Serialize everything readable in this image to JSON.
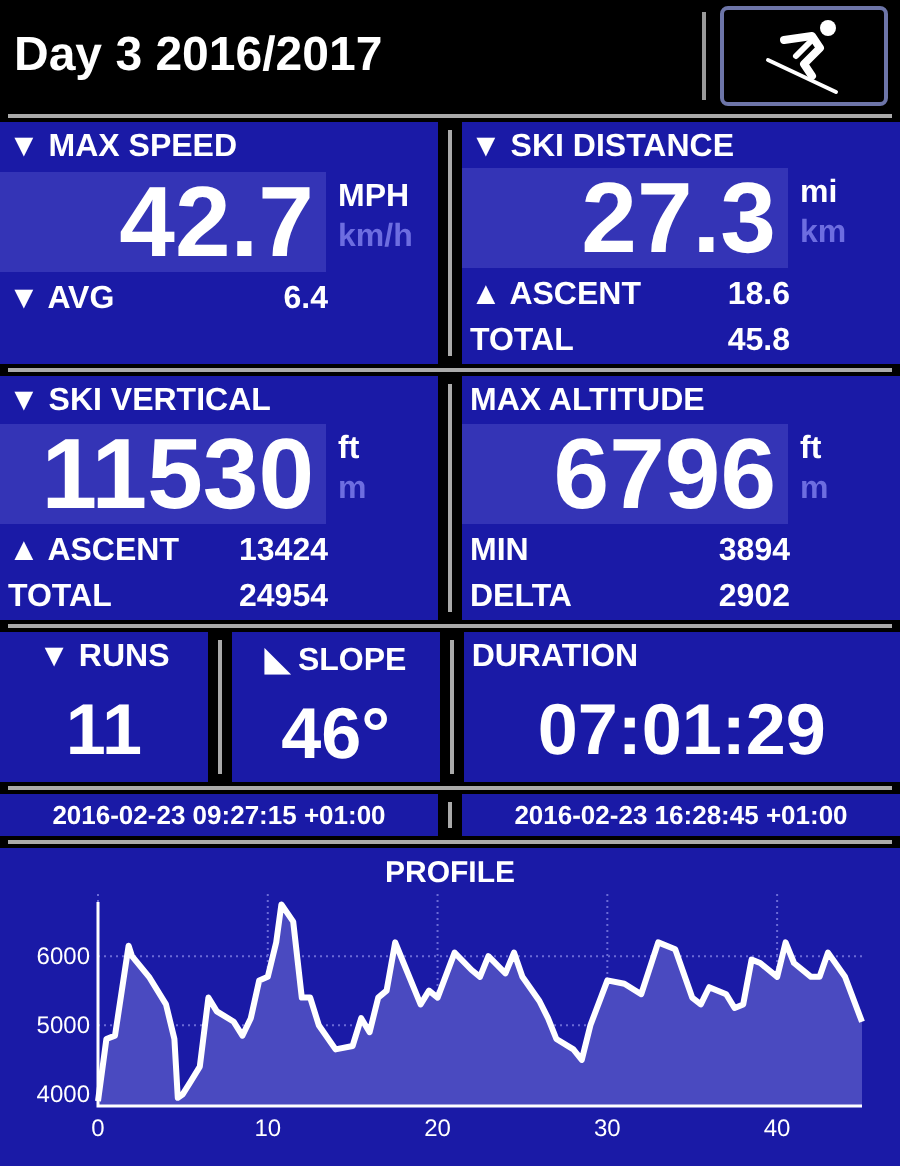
{
  "header": {
    "title": "Day 3 2016/2017"
  },
  "panels": [
    {
      "label": "▼ MAX SPEED",
      "value": "42.7",
      "units": [
        {
          "label": "MPH",
          "selected": true
        },
        {
          "label": "km/h",
          "selected": false
        }
      ],
      "stats": [
        {
          "label": "▼ AVG",
          "value": "6.4"
        }
      ]
    },
    {
      "label": "▼ SKI DISTANCE",
      "value": "27.3",
      "units": [
        {
          "label": "mi",
          "selected": true
        },
        {
          "label": "km",
          "selected": false
        }
      ],
      "stats": [
        {
          "label": "▲ ASCENT",
          "value": "18.6"
        },
        {
          "label": "TOTAL",
          "value": "45.8"
        }
      ]
    },
    {
      "label": "▼ SKI VERTICAL",
      "value": "11530",
      "units": [
        {
          "label": "ft",
          "selected": true
        },
        {
          "label": "m",
          "selected": false
        }
      ],
      "stats": [
        {
          "label": "▲ ASCENT",
          "value": "13424"
        },
        {
          "label": "TOTAL",
          "value": "24954"
        }
      ]
    },
    {
      "label": "MAX ALTITUDE",
      "value": "6796",
      "units": [
        {
          "label": "ft",
          "selected": true
        },
        {
          "label": "m",
          "selected": false
        }
      ],
      "stats": [
        {
          "label": "MIN",
          "value": "3894"
        },
        {
          "label": "DELTA",
          "value": "2902"
        }
      ]
    }
  ],
  "summary": [
    {
      "label": "▼ RUNS",
      "value": "11"
    },
    {
      "label": "◣ SLOPE",
      "value": "46°"
    },
    {
      "label": "DURATION",
      "value": "07:01:29"
    }
  ],
  "timestamps": [
    "2016-02-23 09:27:15 +01:00",
    "2016-02-23 16:28:45 +01:00"
  ],
  "profile": {
    "title": "PROFILE",
    "chart_data": {
      "type": "area",
      "xlim": [
        0,
        45
      ],
      "ylim": [
        3830,
        6900
      ],
      "xticks": [
        0,
        10,
        20,
        30,
        40
      ],
      "yticks": [
        4000,
        5000,
        6000
      ],
      "x": [
        0,
        0.5,
        1,
        1.8,
        2,
        3,
        4,
        4.5,
        4.7,
        5,
        5.5,
        6,
        6.5,
        7,
        8,
        8.5,
        9,
        9.5,
        10,
        10.5,
        10.8,
        11.5,
        12,
        12.5,
        13,
        14,
        15,
        15.5,
        16,
        16.5,
        17,
        17.5,
        18,
        19,
        19.5,
        20,
        21,
        22,
        22.5,
        23,
        24,
        24.5,
        25,
        26,
        26.5,
        27,
        28,
        28.5,
        29,
        30,
        31,
        32,
        33,
        34,
        35,
        35.5,
        36,
        37,
        37.5,
        38,
        38.5,
        39,
        40,
        40.5,
        41,
        42,
        42.5,
        43,
        44,
        45
      ],
      "grid": true,
      "series": [
        {
          "color": "#ffffff",
          "values": [
            3900,
            4800,
            4850,
            6150,
            6000,
            5700,
            5300,
            4800,
            3950,
            4000,
            4200,
            4400,
            5400,
            5200,
            5050,
            4850,
            5100,
            5650,
            5700,
            6200,
            6750,
            6500,
            5400,
            5400,
            5000,
            4650,
            4700,
            5100,
            4900,
            5400,
            5500,
            6200,
            5900,
            5300,
            5500,
            5400,
            6050,
            5800,
            5700,
            6000,
            5750,
            6050,
            5700,
            5350,
            5100,
            4800,
            4650,
            4500,
            5000,
            5650,
            5600,
            5450,
            6200,
            6100,
            5400,
            5300,
            5550,
            5450,
            5250,
            5300,
            5950,
            5900,
            5700,
            6200,
            5900,
            5700,
            5700,
            6050,
            5700,
            5050
          ]
        }
      ]
    }
  }
}
